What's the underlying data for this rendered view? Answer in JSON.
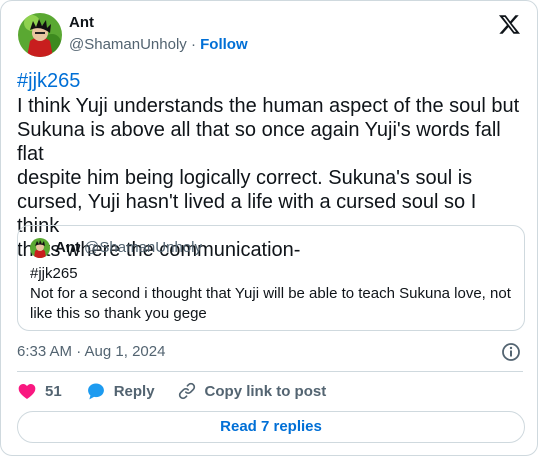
{
  "author": {
    "name": "Ant",
    "handle": "@ShamanUnholy",
    "separator": "·",
    "follow_label": "Follow"
  },
  "tweet": {
    "hashtag": "#jjk265",
    "text": "I think Yuji understands the human aspect of the soul but\nSukuna is above all that so once again Yuji's words fall flat\ndespite him being logically correct. Sukuna's soul is\ncursed, Yuji hasn't lived a life with a cursed soul so I think\nthats where the communication-",
    "timestamp": "6:33 AM · Aug 1, 2024"
  },
  "quote": {
    "name": "Ant",
    "handle": "@ShamanUnholy",
    "text": "#jjk265\nNot for a second i thought that Yuji will be able to teach Sukuna love, not\nlike this so thank you gege"
  },
  "actions": {
    "like_count": "51",
    "reply_label": "Reply",
    "copy_label": "Copy link to post"
  },
  "read_replies_label": "Read 7 replies",
  "icons": {
    "brand": "x-logo-icon",
    "info": "info-icon",
    "like": "heart-icon",
    "reply": "speech-bubble-icon",
    "copy": "link-icon"
  },
  "colors": {
    "link": "#006fd6",
    "like": "#f91880",
    "reply": "#1d9bf0",
    "muted": "#536471",
    "border": "#cfd9de"
  }
}
